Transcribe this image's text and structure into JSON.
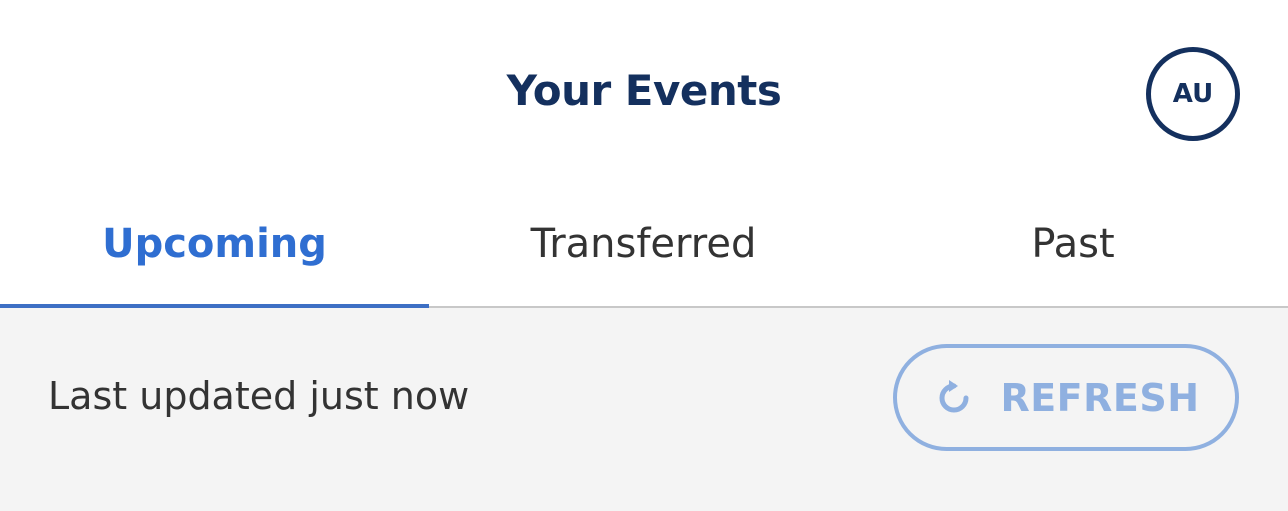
{
  "header": {
    "title": "Your Events",
    "avatar_initials": "AU"
  },
  "tabs": [
    {
      "label": "Upcoming",
      "active": true
    },
    {
      "label": "Transferred",
      "active": false
    },
    {
      "label": "Past",
      "active": false
    }
  ],
  "status": {
    "last_updated": "Last updated just now"
  },
  "refresh": {
    "label": "REFRESH",
    "icon": "refresh-icon"
  },
  "colors": {
    "title": "#14305e",
    "active_tab": "#2f6ed1",
    "refresh": "#8fb0e0",
    "content_bg": "#f4f4f4"
  }
}
